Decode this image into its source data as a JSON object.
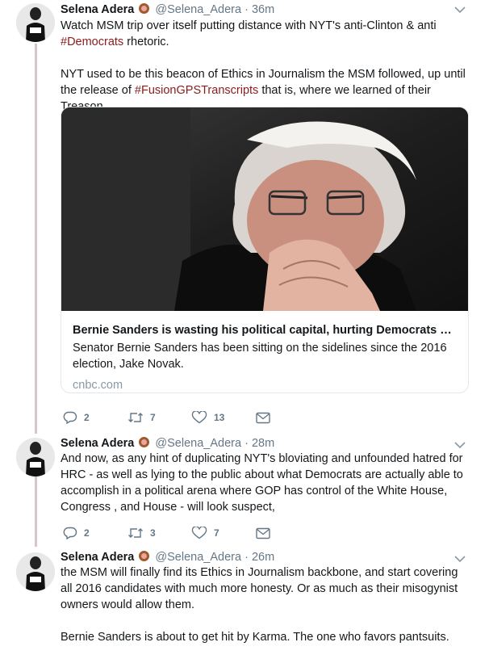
{
  "tweets": [
    {
      "name": "Selena Adera",
      "handle": "@Selena_Adera",
      "dot": "·",
      "time": "36m",
      "text_parts": [
        "Watch MSM trip over itself putting distance with NYT's anti-Clinton & anti",
        "#Democrats",
        "rhetoric."
      ],
      "text2_parts": [
        "NYT used to be this beacon of Ethics in Journalism the MSM followed, up until the release of",
        "#FusionGPSTranscripts",
        "that is, where we learned of their Treason."
      ],
      "card": {
        "title": "Bernie Sanders is wasting his political capital, hurting Democrats ai...",
        "description": "Senator Bernie Sanders has been sitting on the sidelines since the 2016 election, Jake Novak.",
        "domain": "cnbc.com"
      },
      "replies": "2",
      "retweets": "7",
      "likes": "13"
    },
    {
      "name": "Selena Adera",
      "handle": "@Selena_Adera",
      "dot": "·",
      "time": "28m",
      "text": "And now, as any hint of duplicating NYT's bloviating and unfounded hatred for HRC - as well as lying to the public about what Democrats are actually able to accomplish in a political arena where GOP has control of the White House, Congress , and House - will look suspect,",
      "replies": "2",
      "retweets": "3",
      "likes": "7"
    },
    {
      "name": "Selena Adera",
      "handle": "@Selena_Adera",
      "dot": "·",
      "time": "26m",
      "text": "the MSM will finally find its Ethics in Journalism backbone, and start covering all 2016 candidates with much more honesty. Or as much as their misogynist owners would allow them.",
      "text2": "Bernie Sanders is about to get hit by Karma. The one who favors pantsuits."
    }
  ],
  "colors": {
    "hashtag": "#8a1c1c",
    "thread_line": "#d9c4c9",
    "meta": "#657786"
  }
}
